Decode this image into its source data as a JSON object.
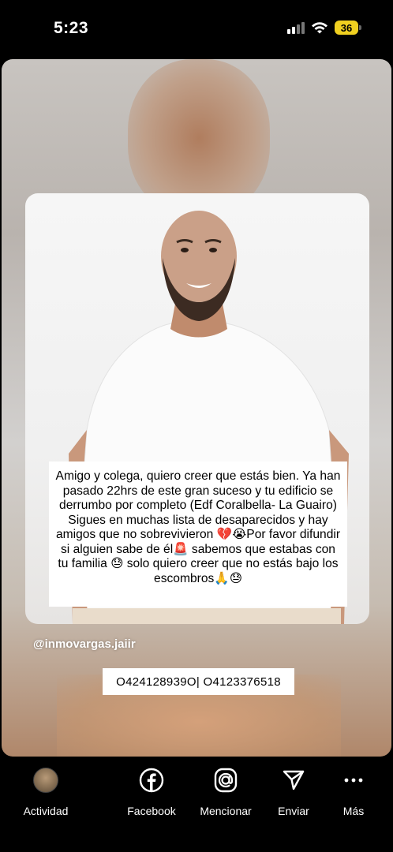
{
  "status_bar": {
    "time": "5:23",
    "battery": "36"
  },
  "story": {
    "caption": "Amigo y colega, quiero creer que estás bien. Ya han pasado 22hrs de este gran suceso y tu edificio se derrumbo por completo (Edf Coralbella- La Guairo) Sigues en muchas lista de desaparecidos y hay amigos que no sobrevivieron 💔😭Por favor difundir si alguien sabe de él🚨 sabemos que estabas con tu familia 😓 solo quiero creer que no estás bajo los escombros🙏😓",
    "username": "@inmovargas.jaiir",
    "phones": "O424128939O| O4123376518"
  },
  "actions": [
    {
      "label": "Actividad",
      "icon": "avatar"
    },
    {
      "label": "Facebook",
      "icon": "facebook-icon"
    },
    {
      "label": "Mencionar",
      "icon": "mention-icon"
    },
    {
      "label": "Enviar",
      "icon": "send-icon"
    },
    {
      "label": "Más",
      "icon": "more-icon"
    }
  ]
}
